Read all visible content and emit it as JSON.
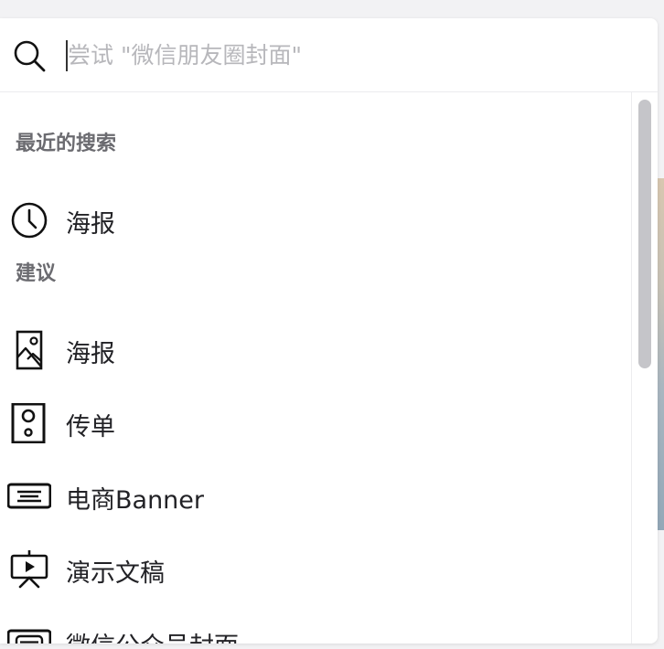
{
  "search": {
    "placeholder": "尝试 \"微信朋友圈封面\"",
    "value": ""
  },
  "sections": {
    "recent_title": "最近的搜索",
    "suggest_title": "建议"
  },
  "recent": [
    {
      "label": "海报",
      "icon": "clock-icon"
    }
  ],
  "suggestions": [
    {
      "label": "海报",
      "icon": "poster-image-icon"
    },
    {
      "label": "传单",
      "icon": "speaker-flyer-icon"
    },
    {
      "label": "电商Banner",
      "icon": "banner-icon"
    },
    {
      "label": "演示文稿",
      "icon": "presentation-icon"
    },
    {
      "label": "微信公众号封面",
      "icon": "wechat-cover-icon"
    }
  ],
  "scrollbar": {
    "position": 0.0
  },
  "colors": {
    "text": "#222226",
    "section": "#6b6b70",
    "placeholder": "#b7b7bb",
    "scroll_thumb": "#c5c5c9"
  }
}
